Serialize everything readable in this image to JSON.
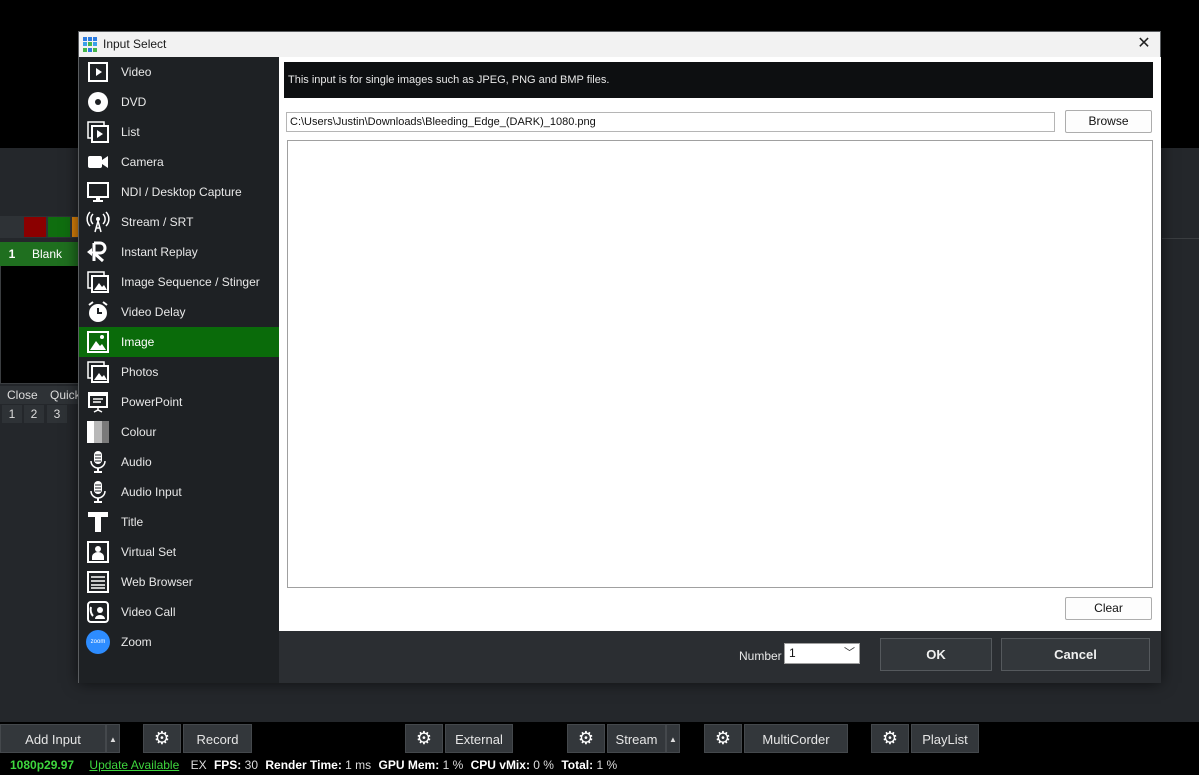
{
  "colors": {
    "accent_green": "#0a6b0a",
    "status_green": "#3ed63e",
    "swatch_red": "#8b0000",
    "swatch_green": "#0f6e0f",
    "swatch_orange": "#d9800a",
    "zoom_blue": "#2d8cff"
  },
  "background": {
    "input_number": "1",
    "input_name": "Blank",
    "close_label": "Close",
    "quick_label": "Quick",
    "mini_numbers": [
      "1",
      "2",
      "3"
    ]
  },
  "toolbar": {
    "add_input": "Add Input",
    "record": "Record",
    "external": "External",
    "stream": "Stream",
    "multicorder": "MultiCorder",
    "playlist": "PlayList"
  },
  "status": {
    "format": "1080p29.97",
    "update": "Update Available",
    "ex": "EX",
    "fps_label": "FPS:",
    "fps_value": "30",
    "render_label": "Render Time:",
    "render_value": "1 ms",
    "gpu_label": "GPU Mem:",
    "gpu_value": "1 %",
    "cpu_label": "CPU vMix:",
    "cpu_value": "0 %",
    "total_label": "Total:",
    "total_value": "1 %"
  },
  "dialog": {
    "title": "Input Select",
    "close_glyph": "✕",
    "sidebar": [
      {
        "label": "Video",
        "icon": "video-icon"
      },
      {
        "label": "DVD",
        "icon": "dvd-icon"
      },
      {
        "label": "List",
        "icon": "list-icon"
      },
      {
        "label": "Camera",
        "icon": "camera-icon"
      },
      {
        "label": "NDI / Desktop Capture",
        "icon": "monitor-icon"
      },
      {
        "label": "Stream / SRT",
        "icon": "antenna-icon"
      },
      {
        "label": "Instant Replay",
        "icon": "replay-icon"
      },
      {
        "label": "Image Sequence / Stinger",
        "icon": "image-sequence-icon"
      },
      {
        "label": "Video Delay",
        "icon": "clock-icon"
      },
      {
        "label": "Image",
        "icon": "image-icon",
        "selected": true
      },
      {
        "label": "Photos",
        "icon": "photos-icon"
      },
      {
        "label": "PowerPoint",
        "icon": "presentation-icon"
      },
      {
        "label": "Colour",
        "icon": "colour-icon"
      },
      {
        "label": "Audio",
        "icon": "microphone-icon"
      },
      {
        "label": "Audio Input",
        "icon": "microphone-icon"
      },
      {
        "label": "Title",
        "icon": "title-icon"
      },
      {
        "label": "Virtual Set",
        "icon": "virtual-set-icon"
      },
      {
        "label": "Web Browser",
        "icon": "web-browser-icon"
      },
      {
        "label": "Video Call",
        "icon": "video-call-icon"
      },
      {
        "label": "Zoom",
        "icon": "zoom-icon",
        "badge": "zoom"
      }
    ],
    "info_text": "This input is for single images such as JPEG, PNG and BMP files.",
    "path_value": "C:\\Users\\Justin\\Downloads\\Bleeding_Edge_(DARK)_1080.png",
    "browse_label": "Browse",
    "clear_label": "Clear",
    "number_label": "Number",
    "number_value": "1",
    "ok_label": "OK",
    "cancel_label": "Cancel"
  }
}
